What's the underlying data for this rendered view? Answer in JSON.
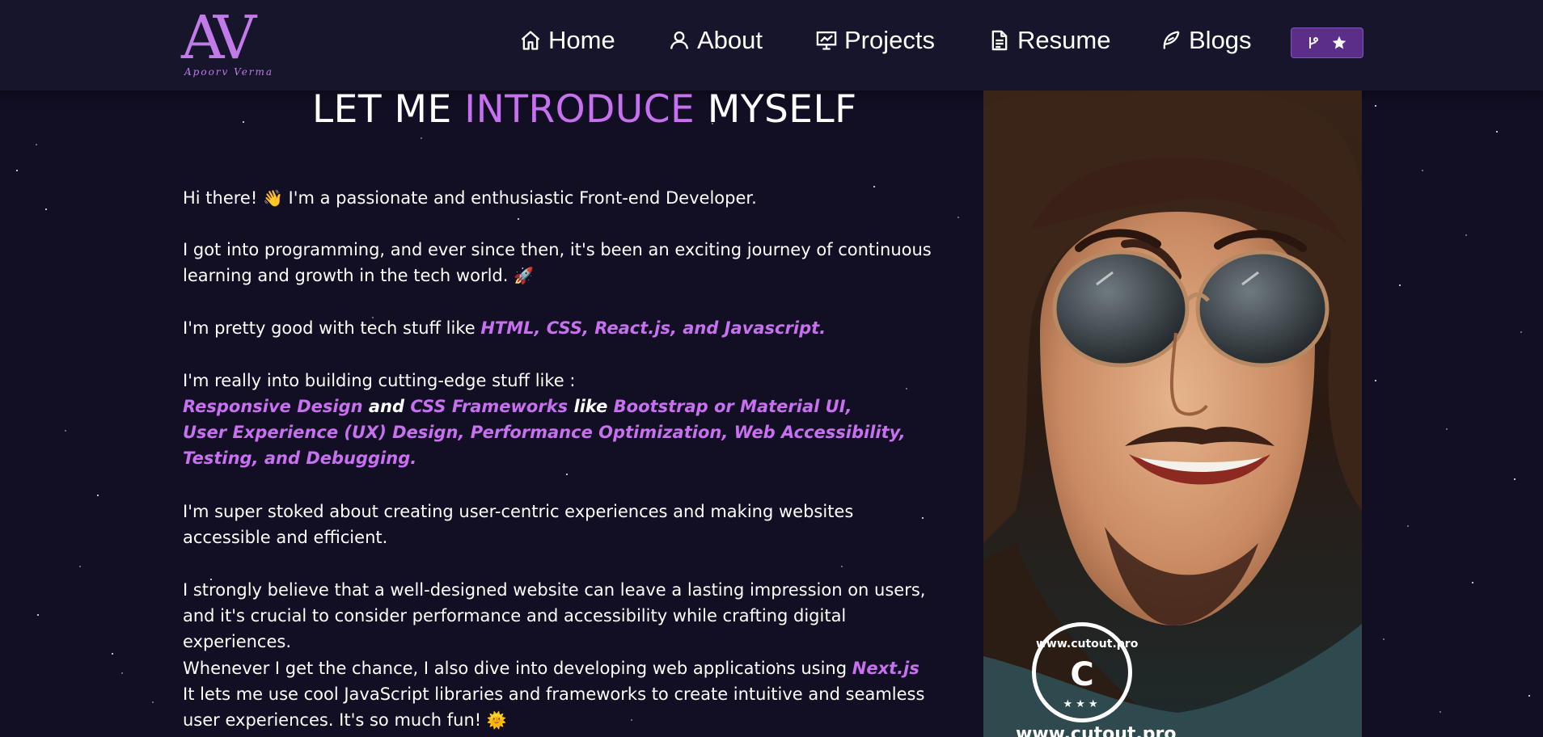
{
  "logo": {
    "monogram": "AV",
    "signature": "Apoorv Verma"
  },
  "nav": {
    "items": [
      {
        "label": "Home",
        "icon": "home-icon"
      },
      {
        "label": "About",
        "icon": "user-icon"
      },
      {
        "label": "Projects",
        "icon": "presentation-icon"
      },
      {
        "label": "Resume",
        "icon": "document-icon"
      },
      {
        "label": "Blogs",
        "icon": "feather-icon"
      }
    ],
    "fork_button": {
      "icons": [
        "git-branch-icon",
        "star-icon"
      ]
    }
  },
  "intro": {
    "heading_pre": "LET ME",
    "heading_accent": "INTRODUCE",
    "heading_post": "MYSELF",
    "p1_text": "Hi there! ",
    "p1_emoji": "👋",
    "p1_rest": " I'm a passionate and enthusiastic Front-end Developer.",
    "p2_text": "I got into programming, and ever since then, it's been an exciting journey of continuous learning and growth in the tech world. ",
    "p2_emoji": "🚀",
    "p3_text": "I'm pretty good with tech stuff like ",
    "p3_highlight": "HTML, CSS, React.js, and Javascript.",
    "p4_line1": "I'm really into building cutting-edge stuff like :",
    "p4_hl1": "Responsive Design",
    "p4_w1": " and ",
    "p4_hl2": "CSS Frameworks",
    "p4_w2": " like ",
    "p4_hl3": "Bootstrap or Material UI,",
    "p4_hl4": "User Experience (UX) Design, Performance Optimization, Web Accessibility, Testing, and Debugging.",
    "p5_text": "I'm super stoked about creating user-centric experiences and making websites accessible and efficient.",
    "p6_text": "I strongly believe that a well-designed website can leave a lasting impression on users, and it's crucial to consider performance and accessibility while crafting digital experiences.",
    "p7_text": "Whenever I get the chance, I also dive into developing web applications using ",
    "p7_highlight": "Next.js",
    "p7_line2": "It lets me use cool JavaScript libraries and frameworks to create intuitive and seamless user experiences. It's so much fun! ",
    "p7_emoji": "🌞"
  },
  "photo": {
    "badge_text": "www.cutout.pro",
    "badge_letter": "C",
    "watermark_text": "www.cutout.pro"
  },
  "colors": {
    "background": "#120e24",
    "navbar": "#16152b",
    "accent": "#c770f0",
    "fork_button": "#5b2e8a"
  }
}
